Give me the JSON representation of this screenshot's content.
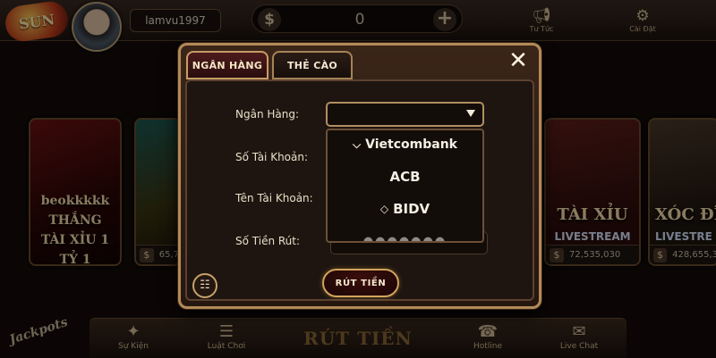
{
  "topbar": {
    "logo_text": "SUN",
    "username": "lamvu1997",
    "balance": {
      "currency_icon": "dollar-icon",
      "value": "0",
      "add_icon": "plus-icon"
    },
    "actions": [
      {
        "label": "Tư Tức",
        "icon": "megaphone-icon"
      },
      {
        "label": "Cài Đặt",
        "icon": "gear-icon"
      }
    ]
  },
  "cards": [
    {
      "title": "beokkkkk THẮNG TÀI XỈU 1 TỶ 1"
    },
    {
      "title": "",
      "price": "65,7"
    },
    {
      "title": "TÀI XỈU",
      "subtitle": "LIVESTREAM",
      "price": "72,535,030"
    },
    {
      "title": "XÓC ĐĨ",
      "subtitle": "LIVESTRE",
      "price": "428,655,3"
    }
  ],
  "jackpot": {
    "text": "Jackpots"
  },
  "bottombar": {
    "center_label": "RÚT TIỀN",
    "items": [
      {
        "label": "Sự Kiện",
        "icon": "party-popper-icon"
      },
      {
        "label": "Luật Chơi",
        "icon": "rules-icon"
      },
      {
        "label": "Hotline",
        "icon": "phone-icon"
      },
      {
        "label": "Live Chat",
        "icon": "chat-icon"
      }
    ]
  },
  "modal": {
    "tabs": [
      {
        "label": "NGÂN HÀNG",
        "active": true
      },
      {
        "label": "THẺ CÀO",
        "active": false
      }
    ],
    "close_icon": "close-icon",
    "fields": {
      "bank": "Ngân Hàng:",
      "account_number": "Số Tài Khoản:",
      "account_name": "Tên Tài Khoản:",
      "amount": "Số Tiền Rút:"
    },
    "bank_options": [
      {
        "name": "Vietcombank",
        "icon": "vietcombank-logo-icon"
      },
      {
        "name": "ACB"
      },
      {
        "name": "BIDV",
        "icon": "bidv-logo-icon"
      }
    ],
    "submit_label": "RÚT TIỀN",
    "history_icon": "history-icon"
  },
  "colors": {
    "modal_border": "#b28a58",
    "active_tab_bg": "#4d1a1c",
    "button_border": "#d3a35a"
  }
}
